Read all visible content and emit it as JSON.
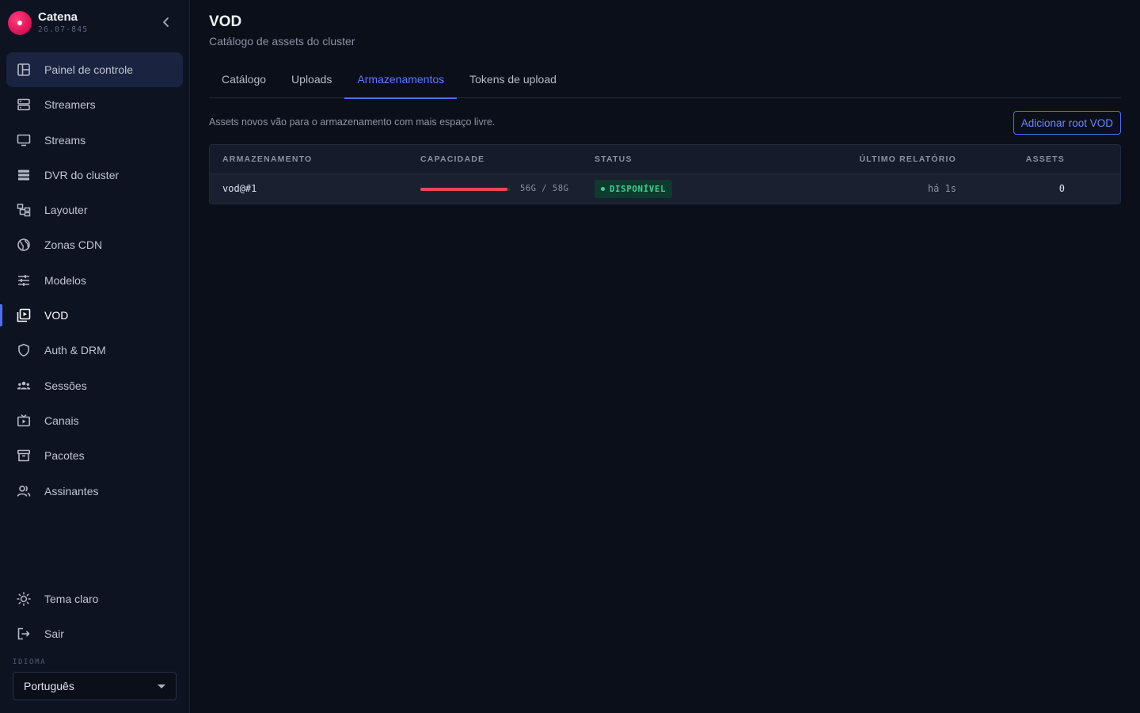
{
  "app": {
    "name": "Catena",
    "version": "26.07-845"
  },
  "sidebar": {
    "items": [
      {
        "label": "Painel de controle",
        "icon": "dashboard-icon"
      },
      {
        "label": "Streamers",
        "icon": "server-icon"
      },
      {
        "label": "Streams",
        "icon": "monitor-icon"
      },
      {
        "label": "DVR do cluster",
        "icon": "storage-icon"
      },
      {
        "label": "Layouter",
        "icon": "layout-icon"
      },
      {
        "label": "Zonas CDN",
        "icon": "globe-icon"
      },
      {
        "label": "Modelos",
        "icon": "sliders-icon"
      },
      {
        "label": "VOD",
        "icon": "video-library-icon"
      },
      {
        "label": "Auth & DRM",
        "icon": "shield-icon"
      },
      {
        "label": "Sessões",
        "icon": "users-group-icon"
      },
      {
        "label": "Canais",
        "icon": "tv-icon"
      },
      {
        "label": "Pacotes",
        "icon": "archive-icon"
      },
      {
        "label": "Assinantes",
        "icon": "subscribers-icon"
      }
    ],
    "active_item": "VOD",
    "theme_label": "Tema claro",
    "logout_label": "Sair",
    "language_label": "IDIOMA",
    "language_value": "Português"
  },
  "page": {
    "title": "VOD",
    "subtitle": "Catálogo de assets do cluster",
    "tabs": [
      "Catálogo",
      "Uploads",
      "Armazenamentos",
      "Tokens de upload"
    ],
    "active_tab": "Armazenamentos",
    "info_text": "Assets novos vão para o armazenamento com mais espaço livre.",
    "add_button": "Adicionar root VOD"
  },
  "table": {
    "columns": [
      "ARMAZENAMENTO",
      "CAPACIDADE",
      "STATUS",
      "ÚLTIMO RELATÓRIO",
      "ASSETS"
    ],
    "rows": [
      {
        "storage": "vod@#1",
        "capacity_text": "56G / 58G",
        "capacity_fraction": 0.9655,
        "status": "DISPONÍVEL",
        "last_report": "há 1s",
        "assets": "0"
      }
    ]
  },
  "colors": {
    "accent": "#4f6ef7",
    "status_ok": "#36d399",
    "capacity_bar": "#f0445c",
    "brand": "#e0145a"
  }
}
